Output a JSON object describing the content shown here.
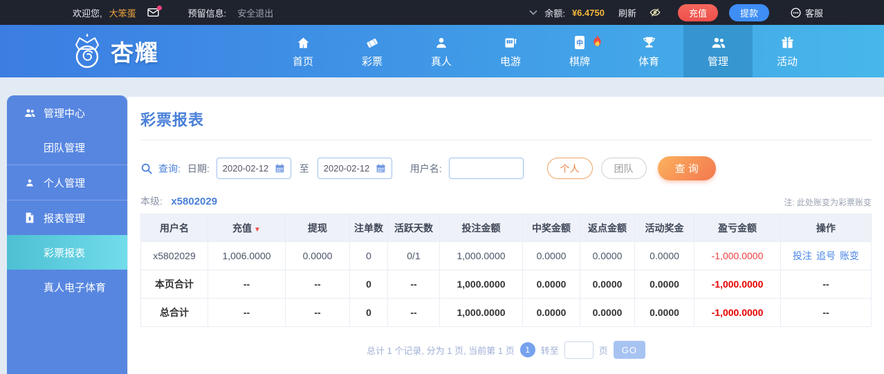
{
  "topbar": {
    "welcome_prefix": "欢迎您,",
    "username": "大笨蛋",
    "reserved_label": "预留信息:",
    "logout_label": "安全退出",
    "balance_label": "余额:",
    "balance_value": "¥6.4750",
    "refresh_label": "刷新",
    "deposit_label": "充值",
    "withdraw_label": "提款",
    "service_label": "客服"
  },
  "nav": {
    "brand": "杏耀",
    "items": [
      {
        "label": "首页",
        "icon": "home-icon"
      },
      {
        "label": "彩票",
        "icon": "ticket-icon"
      },
      {
        "label": "真人",
        "icon": "person-icon"
      },
      {
        "label": "电游",
        "icon": "slot-machine-icon"
      },
      {
        "label": "棋牌",
        "icon": "mahjong-tile-icon",
        "badge": "fire-icon"
      },
      {
        "label": "体育",
        "icon": "trophy-icon"
      },
      {
        "label": "管理",
        "icon": "people-icon",
        "active": true
      },
      {
        "label": "活动",
        "icon": "gift-icon"
      }
    ]
  },
  "sidebar": {
    "groups": [
      {
        "header": {
          "label": "管理中心",
          "icon": "users-icon"
        },
        "items": [
          {
            "label": "团队管理"
          }
        ]
      },
      {
        "header": {
          "label": "个人管理",
          "icon": "user-icon"
        },
        "items": []
      },
      {
        "header": {
          "label": "报表管理",
          "icon": "report-icon"
        },
        "items": [
          {
            "label": "彩票报表",
            "active": true
          },
          {
            "label": "真人电子体育"
          }
        ]
      }
    ]
  },
  "main": {
    "title": "彩票报表",
    "search": {
      "query_label": "查询:",
      "date_label": "日期:",
      "date_from": "2020-02-12",
      "to_label": "至",
      "date_to": "2020-02-12",
      "username_label": "用户名:",
      "username_value": "",
      "personal_button": "个人",
      "team_button": "团队",
      "search_button": "查 询"
    },
    "level_label": "本级:",
    "level_value": "x5802029",
    "note": "注: 此处账变为彩票账变",
    "table": {
      "headers": [
        "用户名",
        "充值",
        "提现",
        "注单数",
        "活跃天数",
        "投注金额",
        "中奖金额",
        "返点金额",
        "活动奖金",
        "盈亏金额",
        "操作"
      ],
      "sort_arrow": "▼",
      "rows": [
        {
          "cells": [
            "x5802029",
            "1,006.0000",
            "0.0000",
            "0",
            "0/1",
            "1,000.0000",
            "0.0000",
            "0.0000",
            "0.0000",
            "-1,000.0000"
          ]
        },
        {
          "cells": [
            "本页合计",
            "--",
            "--",
            "0",
            "--",
            "1,000.0000",
            "0.0000",
            "0.0000",
            "0.0000",
            "-1,000.0000"
          ],
          "ops": "--"
        },
        {
          "cells": [
            "总合计",
            "--",
            "--",
            "0",
            "--",
            "1,000.0000",
            "0.0000",
            "0.0000",
            "0.0000",
            "-1,000.0000"
          ],
          "ops": "--"
        }
      ],
      "actions": [
        "投注",
        "追号",
        "账变"
      ]
    },
    "pagination": {
      "summary": "总计 1 个记录, 分为 1 页, 当前第 1 页",
      "current_page": "1",
      "goto_label": "转至",
      "goto_value": "",
      "page_unit": "页",
      "go_label": "GO"
    }
  },
  "colors": {
    "topbar_bg": "#1f232e",
    "nav_gradient_start": "#3c7de2",
    "nav_gradient_end": "#47b7ea",
    "sidebar_bg": "#5786e0",
    "sidebar_active_start": "#4cc0d2",
    "sidebar_active_end": "#72dceb",
    "accent_blue": "#4a80d8",
    "balance_gold": "#f5b73a",
    "deposit_red": "#ee4f4b",
    "withdraw_blue": "#3e8ef5",
    "search_orange": "#f3774e",
    "danger_red": "#f03e3e",
    "sort_red": "#f56c6c"
  }
}
